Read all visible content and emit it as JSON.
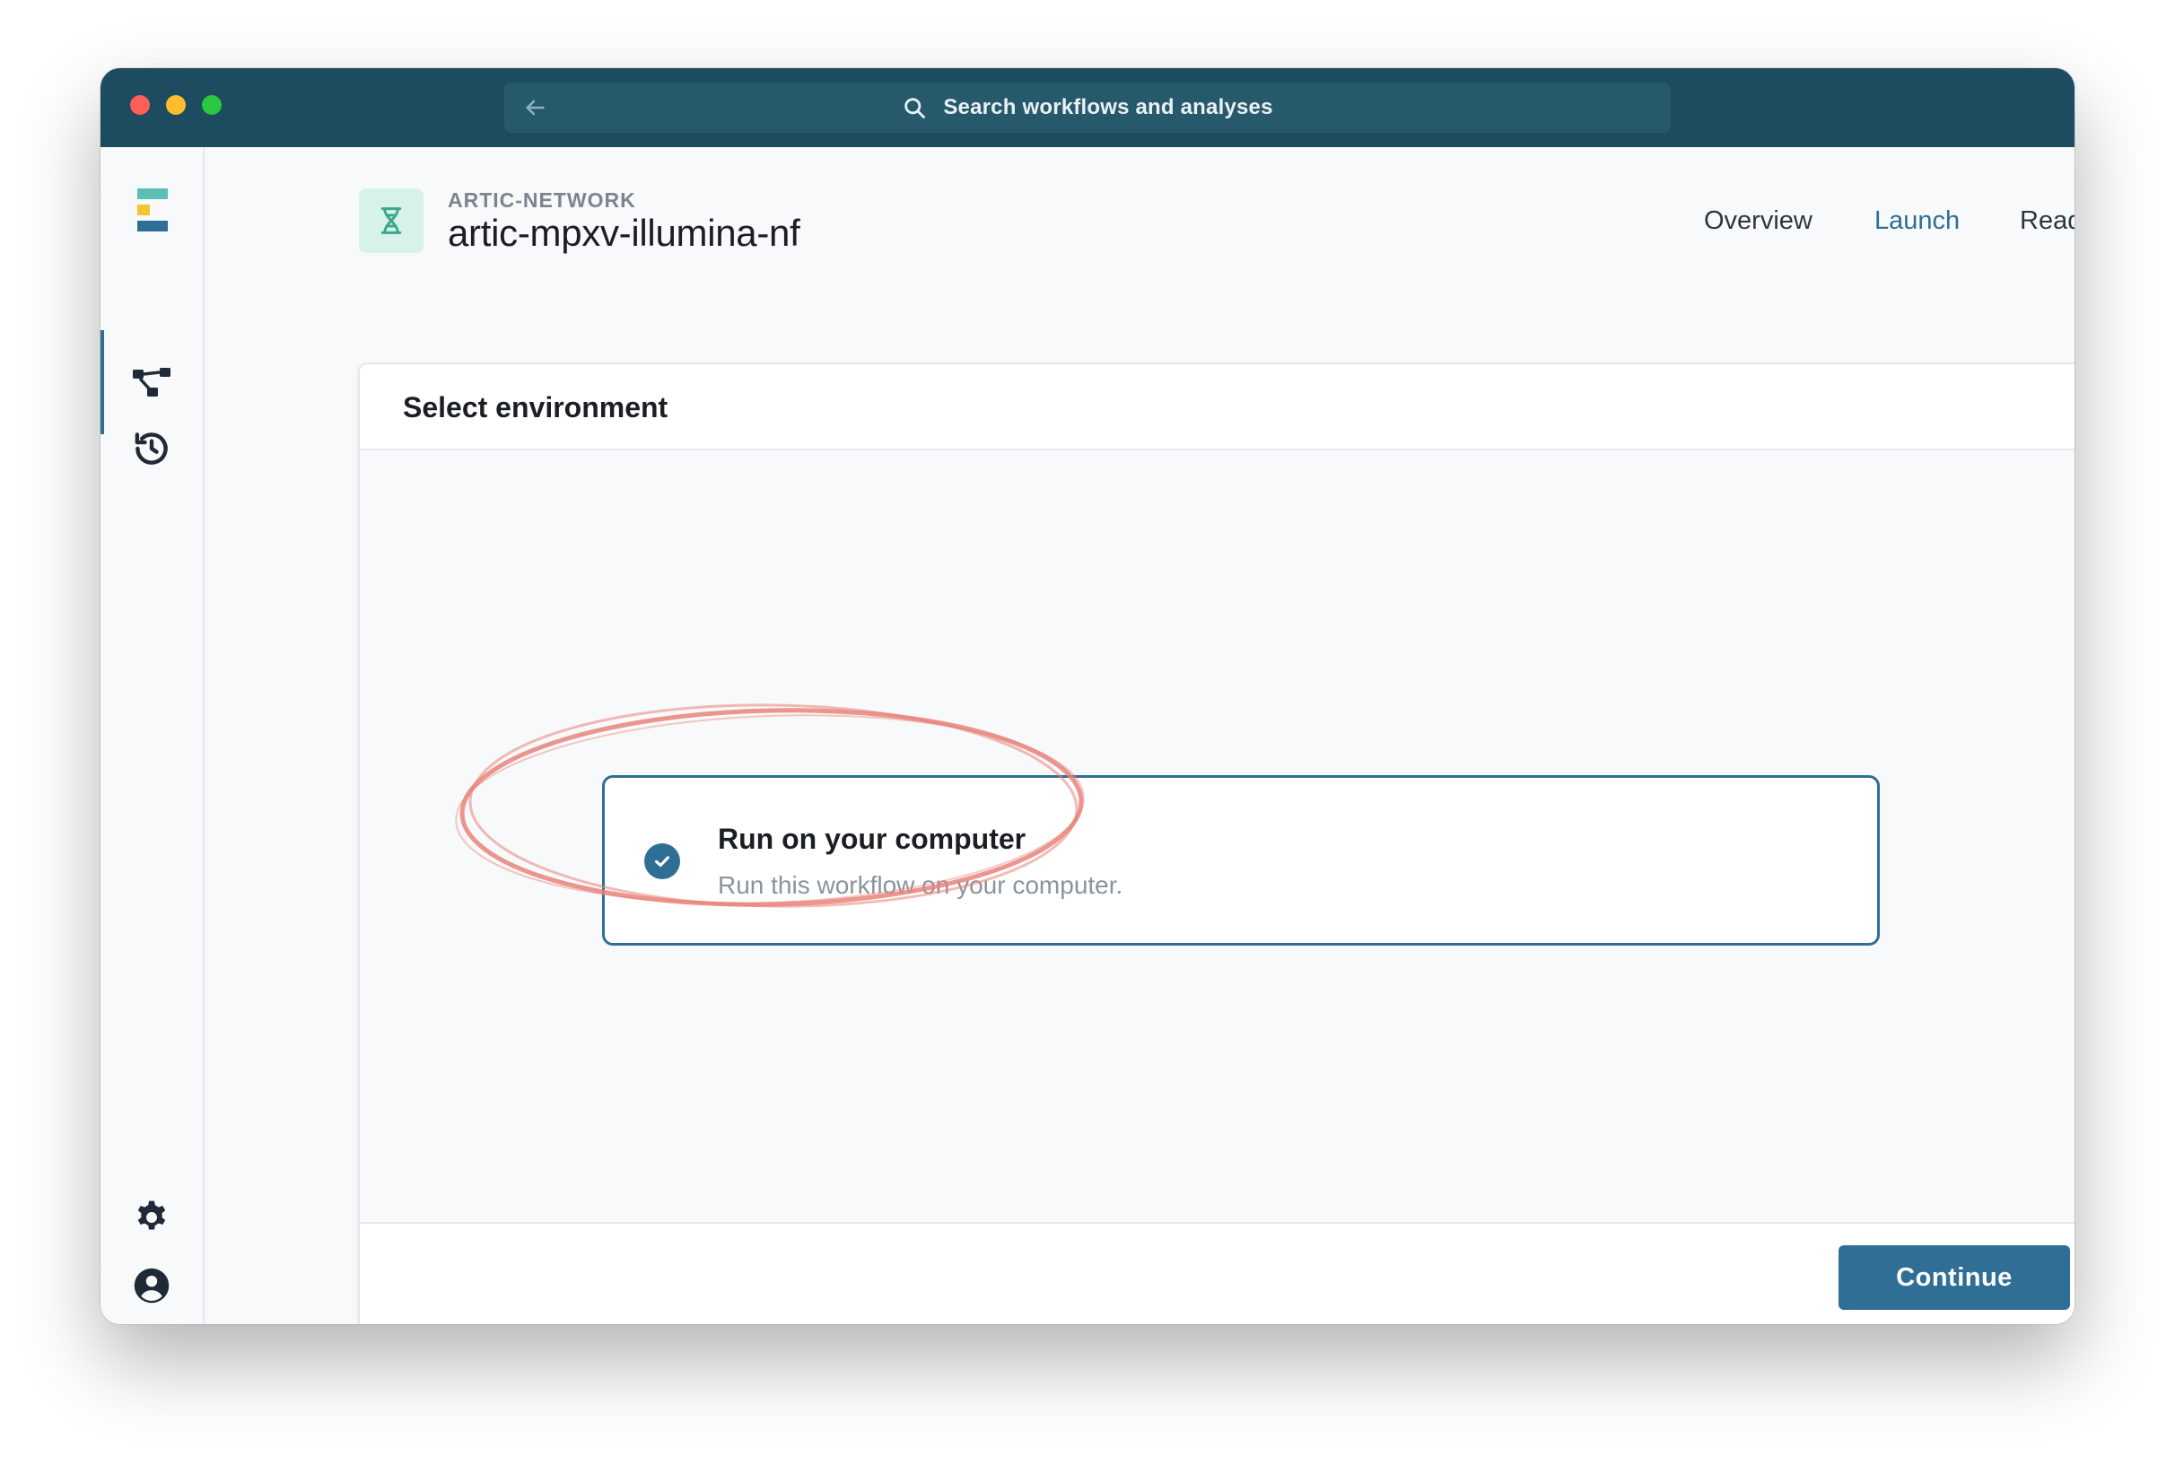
{
  "titlebar": {
    "search_placeholder": "Search workflows and analyses",
    "back_icon": "arrow-left-icon",
    "search_icon": "search-icon"
  },
  "sidebar": {
    "logo_icon": "app-logo-icon",
    "items": [
      {
        "name": "workflows",
        "icon": "workflow-graph-icon",
        "active": true
      },
      {
        "name": "history",
        "icon": "history-icon",
        "active": false
      }
    ],
    "bottom_items": [
      {
        "name": "settings",
        "icon": "gear-icon"
      },
      {
        "name": "account",
        "icon": "user-circle-icon"
      }
    ]
  },
  "workflow": {
    "organization": "ARTIC-NETWORK",
    "name": "artic-mpxv-illumina-nf",
    "icon": "dna-icon"
  },
  "tabs": [
    {
      "label": "Overview",
      "active": false
    },
    {
      "label": "Launch",
      "active": true
    },
    {
      "label": "Readme",
      "active": false
    }
  ],
  "card": {
    "title": "Select environment",
    "option": {
      "title": "Run on your computer",
      "description": "Run this workflow on your computer.",
      "selected": true,
      "check_icon": "check-circle-icon"
    },
    "continue_label": "Continue"
  },
  "colors": {
    "titlebar": "#1d4b5f",
    "accent": "#2f6f95",
    "annotation": "#e8847a",
    "workflow_icon_bg": "#d7f2e8"
  }
}
